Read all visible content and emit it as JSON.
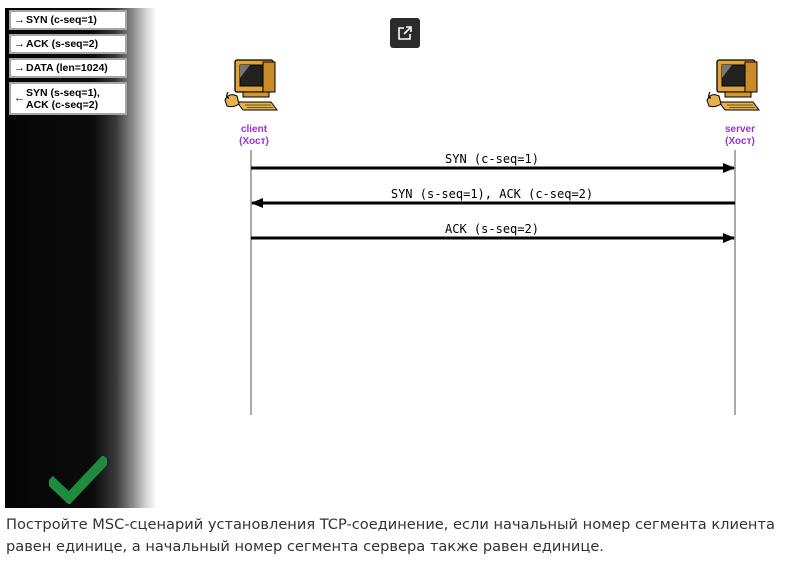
{
  "toolbox": {
    "items": [
      {
        "arrow": "→",
        "label": "SYN (c-seq=1)"
      },
      {
        "arrow": "→",
        "label": "ACK (s-seq=2)"
      },
      {
        "arrow": "→",
        "label": "DATA (len=1024)"
      },
      {
        "arrow": "←",
        "label": "SYN (s-seq=1),\nACK (c-seq=2)"
      }
    ],
    "status": "correct",
    "status_color": "#1e8b3d"
  },
  "diagram": {
    "entities": [
      {
        "name": "client",
        "type": "(Хост)"
      },
      {
        "name": "server",
        "type": "(Хост)"
      }
    ],
    "messages": [
      {
        "from": "client",
        "to": "server",
        "label": "SYN (c-seq=1)"
      },
      {
        "from": "server",
        "to": "client",
        "label": "SYN (s-seq=1), ACK (c-seq=2)"
      },
      {
        "from": "client",
        "to": "server",
        "label": "ACK (s-seq=2)"
      }
    ],
    "entity_label_color": "#9933cc"
  },
  "external_link_icon": "external-link-icon",
  "task": {
    "text": "Постройте MSC-сценарий установления TCP-соединение, если начальный номер сегмента клиента равен единице, а начальный номер сегмента сервера также равен единице."
  }
}
